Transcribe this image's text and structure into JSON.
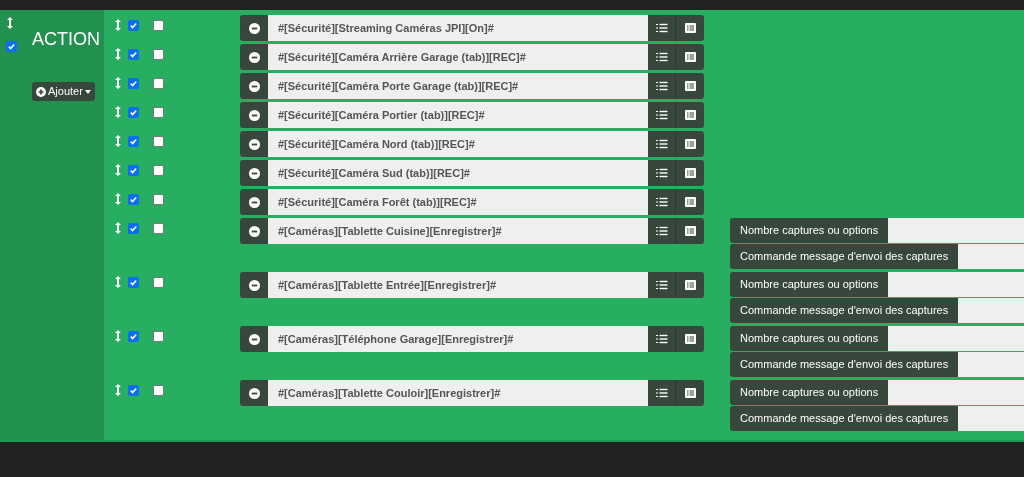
{
  "block": {
    "checked": true,
    "title": "ACTION",
    "add_button": "Ajouter"
  },
  "actions": [
    {
      "enabled": true,
      "checked": false,
      "command": "#[Sécurité][Streaming Caméras JPI][On]#"
    },
    {
      "enabled": true,
      "checked": false,
      "command": "#[Sécurité][Caméra Arrière Garage (tab)][REC]#"
    },
    {
      "enabled": true,
      "checked": false,
      "command": "#[Sécurité][Caméra Porte Garage (tab)][REC]#"
    },
    {
      "enabled": true,
      "checked": false,
      "command": "#[Sécurité][Caméra Portier (tab)][REC]#"
    },
    {
      "enabled": true,
      "checked": false,
      "command": "#[Sécurité][Caméra Nord (tab)][REC]#"
    },
    {
      "enabled": true,
      "checked": false,
      "command": "#[Sécurité][Caméra Sud (tab)][REC]#"
    },
    {
      "enabled": true,
      "checked": false,
      "command": "#[Sécurité][Caméra Forêt (tab)][REC]#"
    },
    {
      "enabled": true,
      "checked": false,
      "command": "#[Caméras][Tablette Cuisine][Enregistrer]#",
      "options": [
        {
          "label": "Nombre captures ou options"
        },
        {
          "label": "Commande message d'envoi des captures"
        }
      ]
    },
    {
      "enabled": true,
      "checked": false,
      "command": "#[Caméras][Tablette Entrée][Enregistrer]#",
      "options": [
        {
          "label": "Nombre captures ou options"
        },
        {
          "label": "Commande message d'envoi des captures"
        }
      ]
    },
    {
      "enabled": true,
      "checked": false,
      "command": "#[Caméras][Téléphone Garage][Enregistrer]#",
      "options": [
        {
          "label": "Nombre captures ou options"
        },
        {
          "label": "Commande message d'envoi des captures"
        }
      ]
    },
    {
      "enabled": true,
      "checked": false,
      "command": "#[Caméras][Tablette Couloir][Enregistrer]#",
      "options": [
        {
          "label": "Nombre captures ou options"
        },
        {
          "label": "Commande message d'envoi des captures"
        }
      ]
    }
  ]
}
